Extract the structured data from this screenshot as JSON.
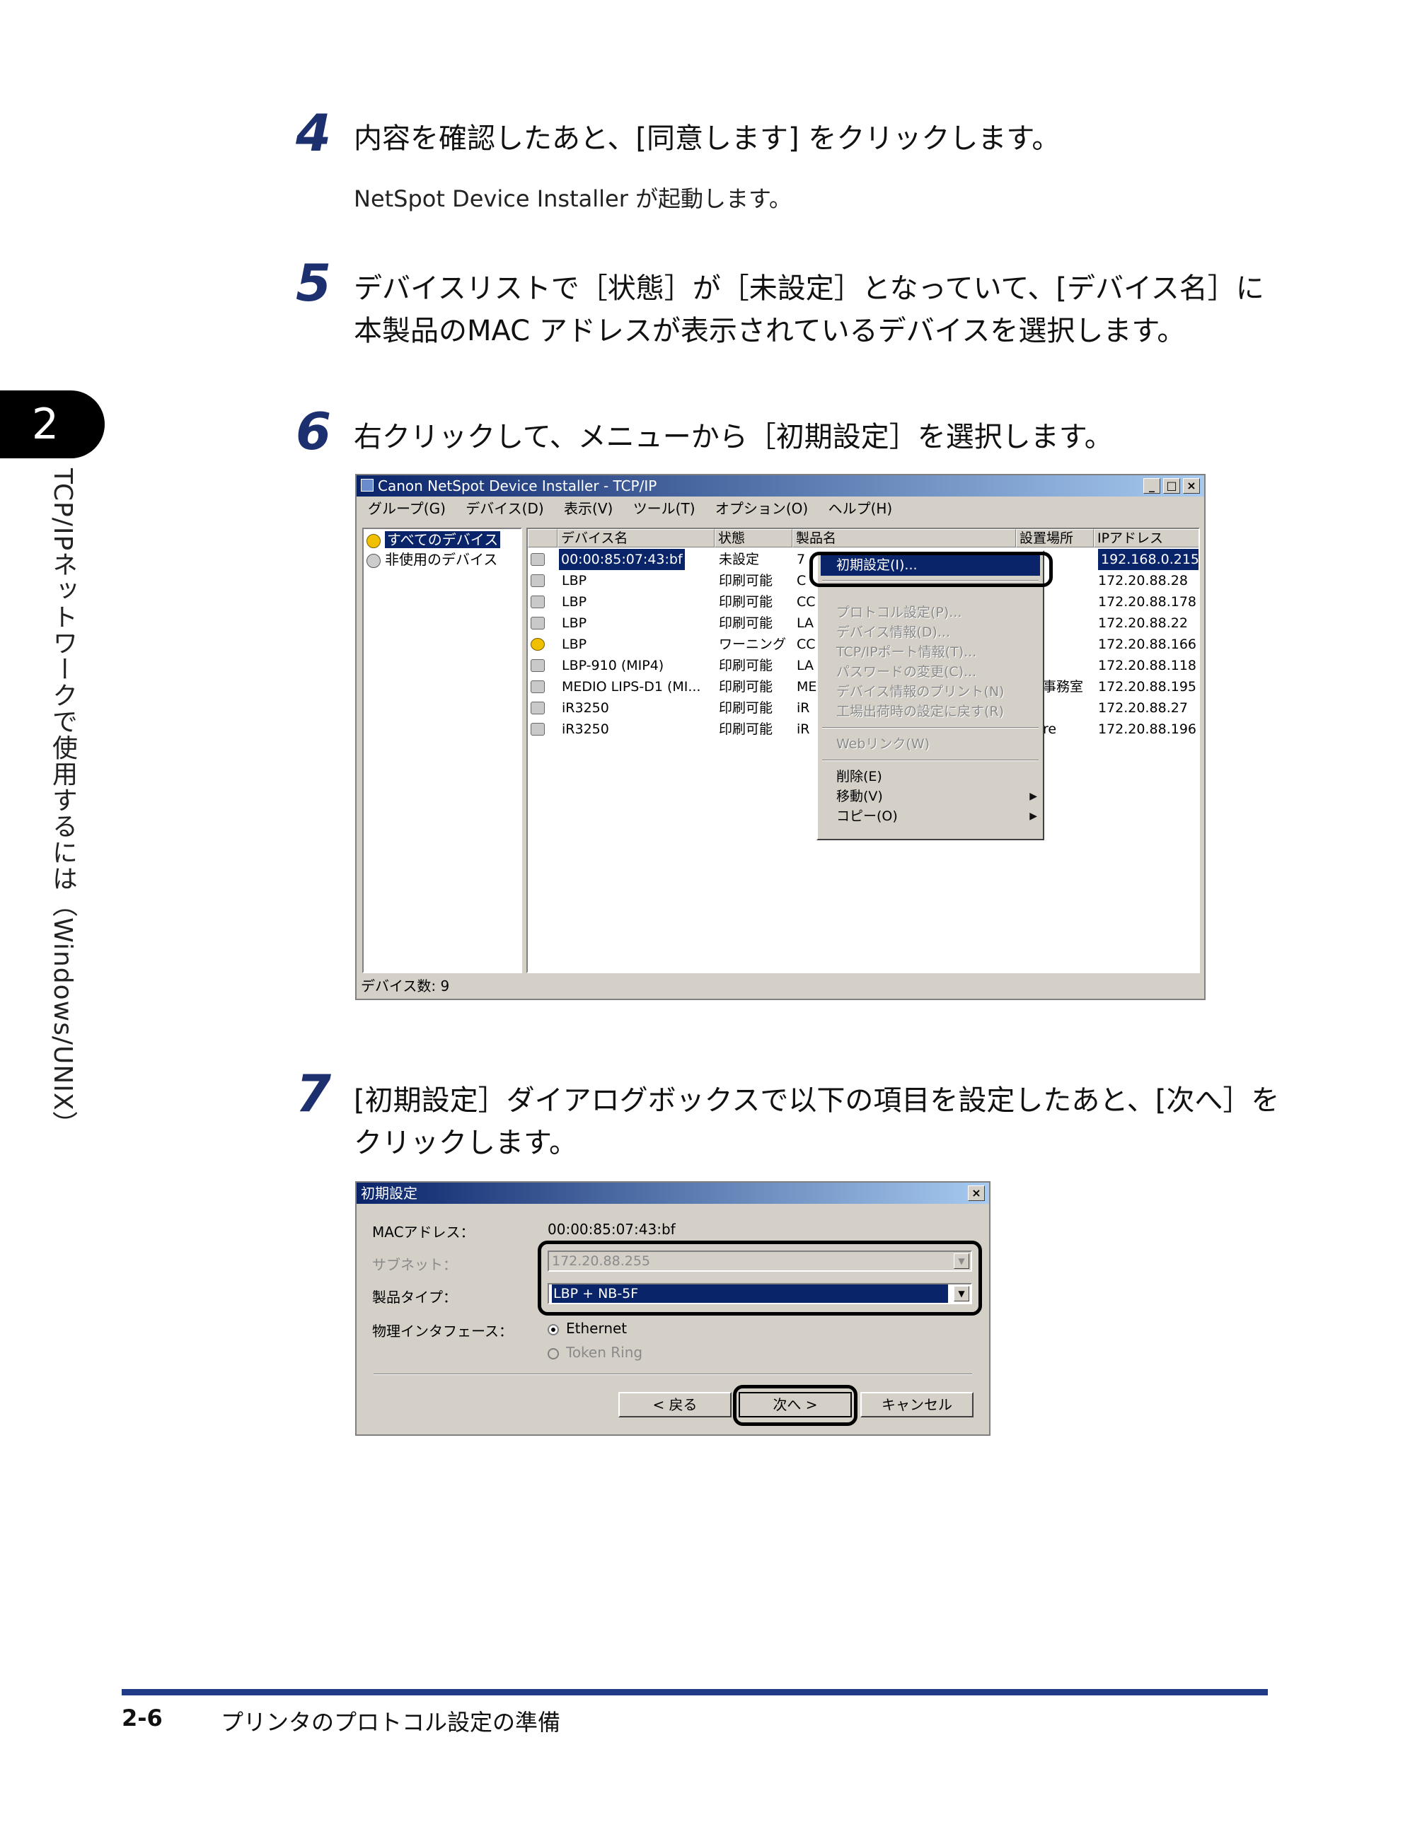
{
  "side_tab": {
    "number": "2",
    "title": "TCP/IPネットワークで使用するには（Windows/UNIX）"
  },
  "steps": [
    {
      "number": "4",
      "text": "内容を確認したあと、[同意します] をクリックします。",
      "sub": "NetSpot Device Installer が起動します。"
    },
    {
      "number": "5",
      "line1": "デバイスリストで［状態］が［未設定］となっていて、[デバイス名］に",
      "line2": "本製品のMAC アドレスが表示されているデバイスを選択します。"
    },
    {
      "number": "6",
      "text": "右クリックして、メニューから［初期設定］を選択します。"
    },
    {
      "number": "7",
      "line1": "[初期設定］ダイアログボックスで以下の項目を設定したあと、[次へ］を",
      "line2": "クリックします。"
    }
  ],
  "app_window": {
    "title": "Canon NetSpot Device Installer - TCP/IP",
    "menu": [
      "グループ(G)",
      "デバイス(D)",
      "表示(V)",
      "ツール(T)",
      "オプション(O)",
      "ヘルプ(H)"
    ],
    "tree": [
      "すべてのデバイス",
      "非使用のデバイス"
    ],
    "columns": [
      "デバイス名",
      "状態",
      "製品名",
      "設置場所",
      "IPアドレス"
    ],
    "rows": [
      {
        "name": "00:00:85:07:43:bf",
        "status": "未設定",
        "product": "7",
        "location": "",
        "ip": "192.168.0.215"
      },
      {
        "name": "LBP",
        "status": "印刷可能",
        "product": "C",
        "location": "",
        "ip": "172.20.88.28"
      },
      {
        "name": "LBP",
        "status": "印刷可能",
        "product": "CC",
        "location": "",
        "ip": "172.20.88.178"
      },
      {
        "name": "LBP",
        "status": "印刷可能",
        "product": "LA",
        "location": "",
        "ip": "172.20.88.22"
      },
      {
        "name": "LBP",
        "status": "ワーニング",
        "product": "CC",
        "location": "",
        "ip": "172.20.88.166"
      },
      {
        "name": "LBP-910 (MIP4)",
        "status": "印刷可能",
        "product": "LA",
        "location": "",
        "ip": "172.20.88.118"
      },
      {
        "name": "MEDIO LIPS-D1 (MI...",
        "status": "印刷可能",
        "product": "ME",
        "location": "事務室",
        "ip": "172.20.88.195"
      },
      {
        "name": "iR3250",
        "status": "印刷可能",
        "product": "iR",
        "location": "",
        "ip": "172.20.88.27"
      },
      {
        "name": "iR3250",
        "status": "印刷可能",
        "product": "iR",
        "location": "re",
        "ip": "172.20.88.196"
      }
    ],
    "context_menu": {
      "highlighted": "初期設定(I)...",
      "group1": [
        "プロトコル設定(P)...",
        "デバイス情報(D)...",
        "TCP/IPポート情報(T)...",
        "パスワードの変更(C)...",
        "デバイス情報のプリント(N)",
        "工場出荷時の設定に戻す(R)"
      ],
      "group2": [
        "Webリンク(W)"
      ],
      "group3": [
        "削除(E)",
        "移動(V)",
        "コピー(O)"
      ]
    },
    "status": "デバイス数: 9"
  },
  "dialog": {
    "title": "初期設定",
    "mac_label": "MACアドレス：",
    "mac_value": "00:00:85:07:43:bf",
    "subnet_label": "サブネット：",
    "subnet_value": "172.20.88.255",
    "product_label": "製品タイプ：",
    "product_value": "LBP + NB-5F",
    "interface_label": "物理インタフェース：",
    "interface_options": [
      "Ethernet",
      "Token Ring"
    ],
    "buttons": {
      "back": "< 戻る",
      "next": "次へ >",
      "cancel": "キャンセル"
    }
  },
  "footer": {
    "page": "2-6",
    "title": "プリンタのプロトコル設定の準備"
  }
}
